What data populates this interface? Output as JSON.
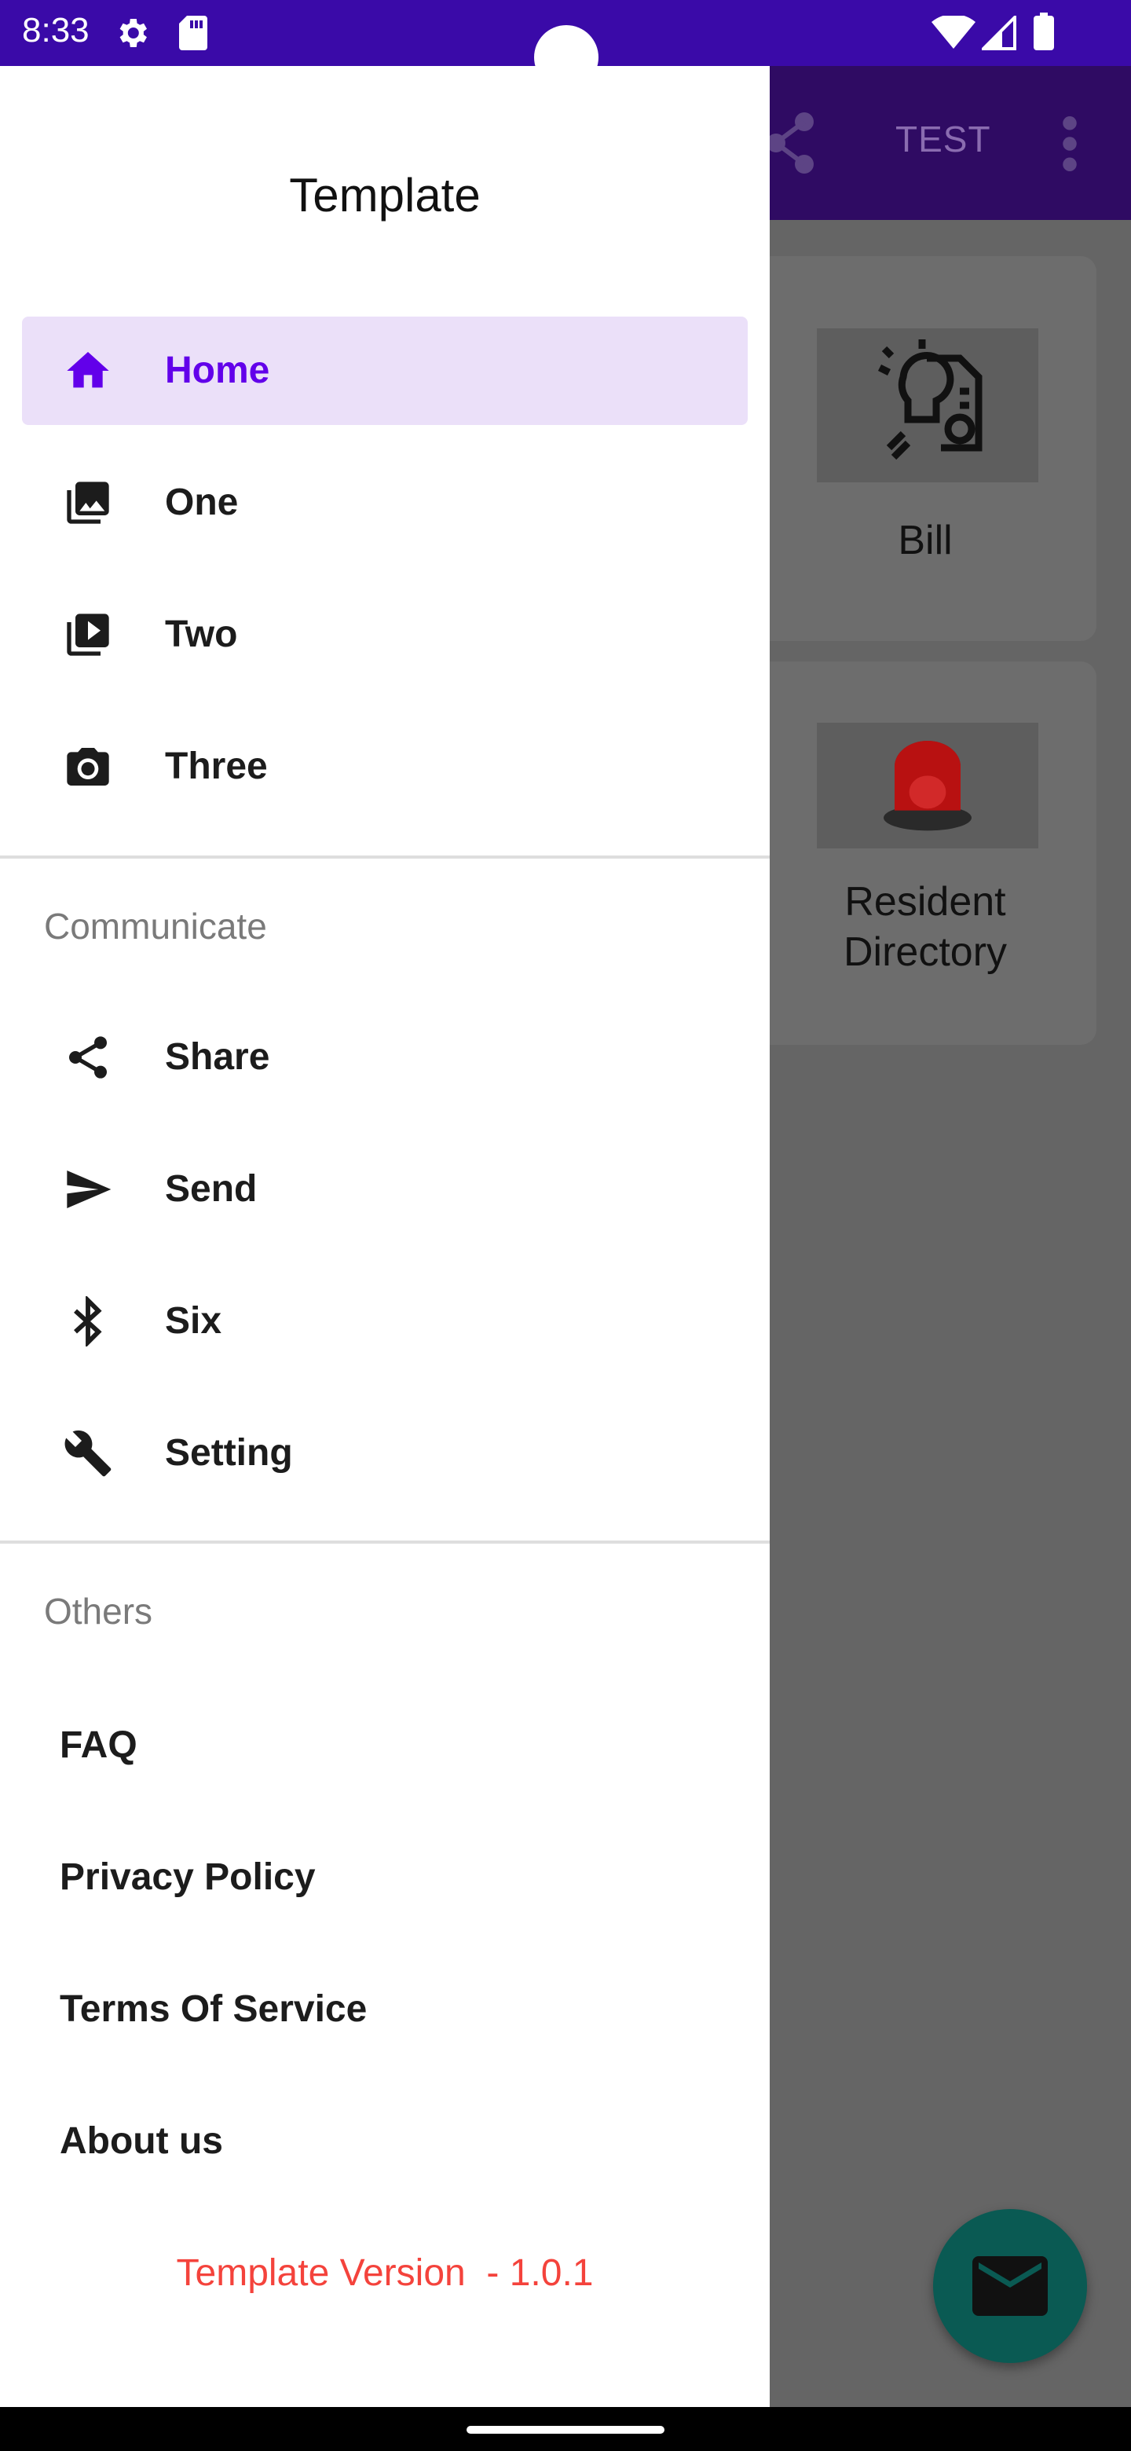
{
  "status_bar": {
    "time": "8:33",
    "icons": [
      "gear-icon",
      "sd-card-icon",
      "wifi-icon",
      "signal-icon",
      "battery-icon"
    ]
  },
  "app": {
    "toolbar": {
      "action_label": "TEST",
      "icons": [
        "share-icon",
        "more-vert-icon"
      ]
    },
    "cards": [
      {
        "label": "Bill",
        "icon": "bulb-bill-icon"
      },
      {
        "label_line1": "Resident",
        "label_line2": "Directory",
        "icon": "red-siren-icon"
      }
    ],
    "fab_icon": "mail-icon"
  },
  "drawer": {
    "title": "Template",
    "main_items": [
      {
        "label": "Home",
        "icon": "home-icon",
        "active": true
      },
      {
        "label": "One",
        "icon": "photo-library-icon"
      },
      {
        "label": "Two",
        "icon": "video-library-icon"
      },
      {
        "label": "Three",
        "icon": "camera-icon"
      }
    ],
    "communicate": {
      "header": "Communicate",
      "items": [
        {
          "label": "Share",
          "icon": "share-icon"
        },
        {
          "label": "Send",
          "icon": "send-icon"
        },
        {
          "label": "Six",
          "icon": "bluetooth-icon"
        },
        {
          "label": "Setting",
          "icon": "wrench-icon"
        }
      ]
    },
    "others": {
      "header": "Others",
      "items": [
        "FAQ",
        "Privacy Policy",
        "Terms Of Service",
        "About us"
      ]
    },
    "version": "Template Version  - 1.0.1"
  },
  "colors": {
    "status_bar": "#3a0aa8",
    "accent": "#6200ea",
    "active_bg": "#ebe0f9",
    "version": "#f4433c",
    "fab": "#0a5a53"
  }
}
